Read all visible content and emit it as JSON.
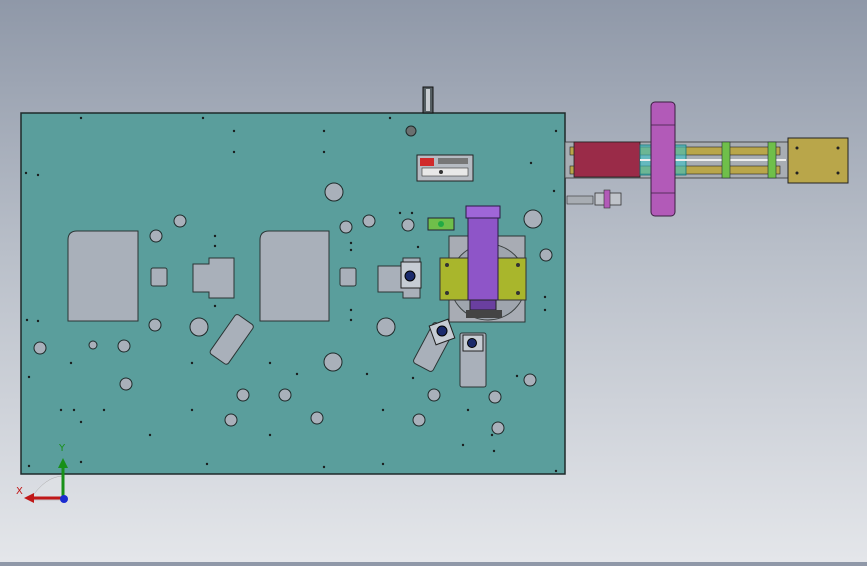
{
  "viewport": {
    "background_top": "#8f98a8",
    "background_bottom": "#e4e6ea"
  },
  "model": {
    "plate_color": "#5a9e9c",
    "plate_edge": "#1e2a2a",
    "cutout_color": "#a9b0ba",
    "cylinder_color": "#8e55c8",
    "bracket_color": "#a9b62c",
    "rail_color": "#b9a64a",
    "red_part_color": "#9a2b48",
    "wheel_color": "#b25ab8",
    "cyan_color": "#39c2c7"
  },
  "triad": {
    "x_label": "X",
    "y_label": "Y",
    "x_color": "#c01818",
    "y_color": "#189018",
    "z_color": "#1a2bd0",
    "x_icon": "arrow-x-icon",
    "y_icon": "arrow-y-icon",
    "z_icon": "origin-z-icon"
  }
}
